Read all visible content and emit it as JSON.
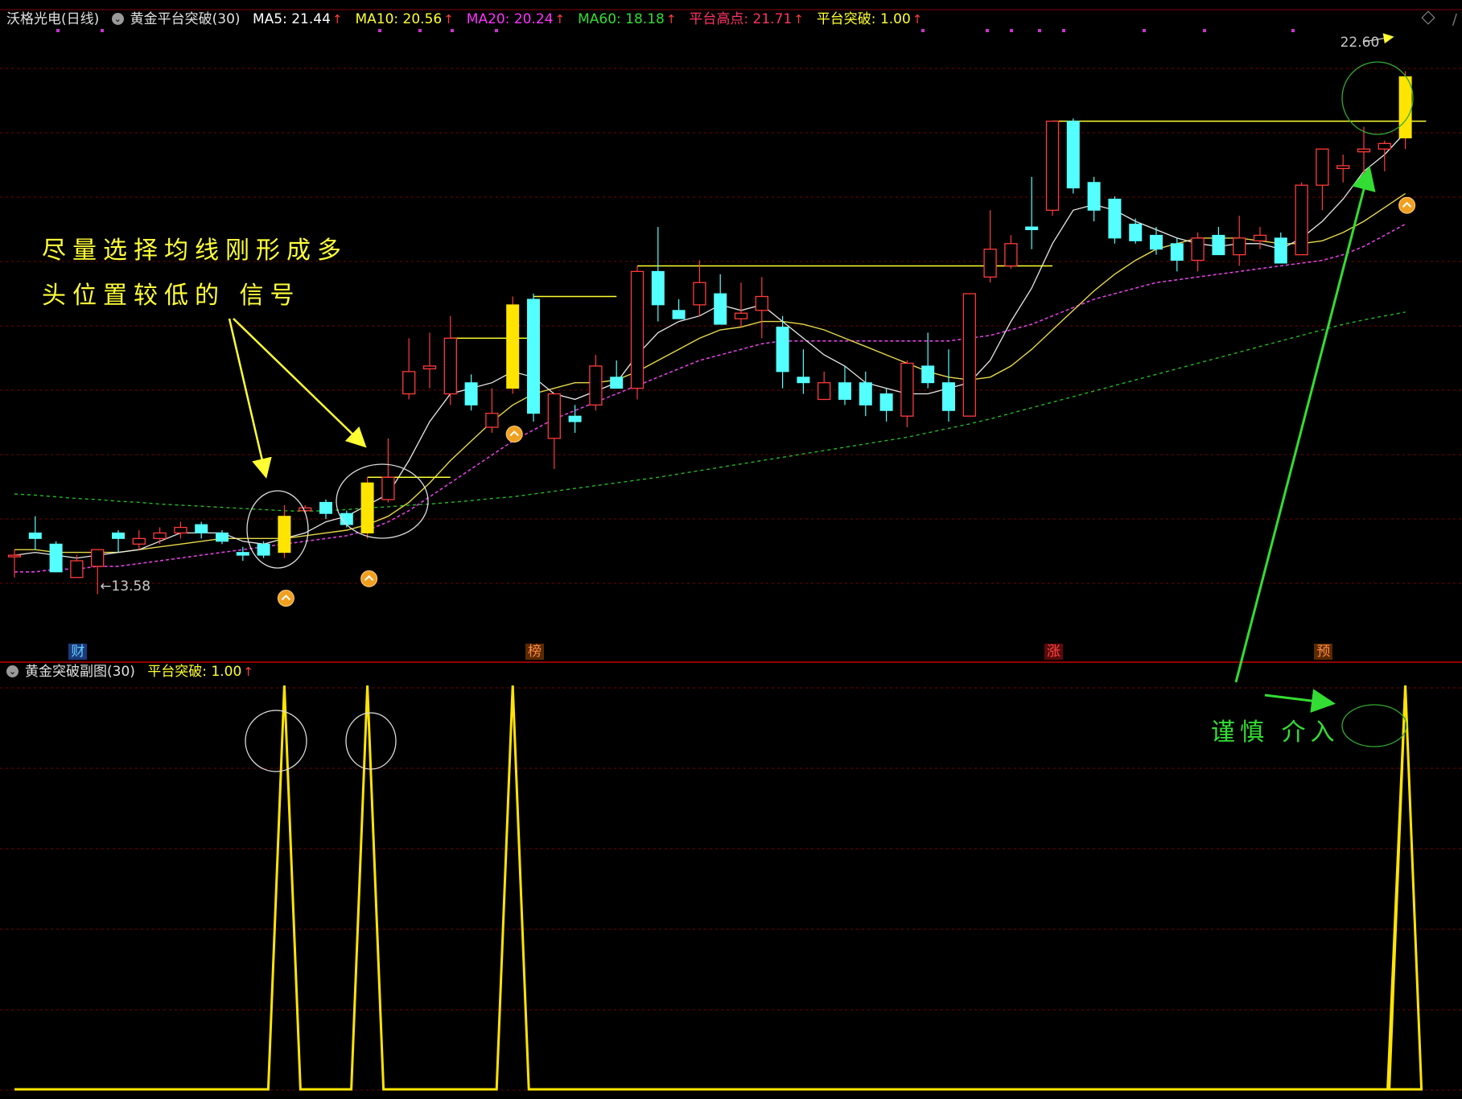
{
  "header": {
    "stock_name": "沃格光电(日线)",
    "indicator_name": "黄金平台突破(30)",
    "items": [
      {
        "label": "MA5: 21.44",
        "color": "#ffffff"
      },
      {
        "label": "MA10: 20.56",
        "color": "#ffff33"
      },
      {
        "label": "MA20: 20.24",
        "color": "#ff33ff"
      },
      {
        "label": "MA60: 18.18",
        "color": "#33dd33"
      },
      {
        "label": "平台高点: 21.71",
        "color": "#ff3366"
      },
      {
        "label": "平台突破: 1.00",
        "color": "#ffff33"
      }
    ]
  },
  "sub_header": {
    "indicator_name": "黄金突破副图(30)",
    "item": {
      "label": "平台突破: 1.00",
      "color": "#ffff33"
    }
  },
  "annotations": {
    "note_line1": "尽量选择均线刚形成多",
    "note_line2": "头位置较低的 信号",
    "note_caution": "谨慎 介入"
  },
  "events": [
    {
      "label": "财",
      "index": 3,
      "color": "#66ccff",
      "bg": "#1a3a7a"
    },
    {
      "label": "榜",
      "index": 25,
      "color": "#ff8844",
      "bg": "#5a2a00"
    },
    {
      "label": "涨",
      "index": 50,
      "color": "#ff4444",
      "bg": "#5a0a0a"
    },
    {
      "label": "预",
      "index": 63,
      "color": "#ff8844",
      "bg": "#5a2a00"
    }
  ],
  "colors": {
    "up": "#ff3b3b",
    "down": "#54ffff",
    "signal": "#ffe400",
    "ma5": "#e8e8e8",
    "ma10": "#e6d84a",
    "ma20": "#e040e0",
    "ma60": "#22bb22",
    "grid": "#7a0000",
    "platform": "#ffff33",
    "callout": "#ffff33",
    "caution": "#33dd33"
  },
  "chart_data": [
    {
      "type": "candlestick",
      "title": "沃格光电(日线)",
      "ylim": [
        12.6,
        23.3
      ],
      "grid": true,
      "price_labels": [
        {
          "index": 4,
          "value": 13.58,
          "text": "←13.58"
        },
        {
          "index": 67,
          "value": 22.6,
          "text": "22.60"
        }
      ],
      "candles": [
        {
          "o": 13.9,
          "h": 14.0,
          "l": 13.5,
          "c": 13.9,
          "s": "up"
        },
        {
          "o": 14.2,
          "h": 14.6,
          "l": 14.0,
          "c": 14.3,
          "s": "down"
        },
        {
          "o": 14.1,
          "h": 14.15,
          "l": 13.6,
          "c": 13.6,
          "s": "down"
        },
        {
          "o": 13.5,
          "h": 13.9,
          "l": 13.5,
          "c": 13.8,
          "s": "up"
        },
        {
          "o": 13.7,
          "h": 14.0,
          "l": 13.2,
          "c": 14.0,
          "s": "up"
        },
        {
          "o": 14.3,
          "h": 14.35,
          "l": 13.95,
          "c": 14.2,
          "s": "down"
        },
        {
          "o": 14.1,
          "h": 14.35,
          "l": 14.0,
          "c": 14.2,
          "s": "up"
        },
        {
          "o": 14.2,
          "h": 14.4,
          "l": 14.1,
          "c": 14.3,
          "s": "up"
        },
        {
          "o": 14.3,
          "h": 14.5,
          "l": 14.2,
          "c": 14.4,
          "s": "up"
        },
        {
          "o": 14.45,
          "h": 14.5,
          "l": 14.2,
          "c": 14.3,
          "s": "down"
        },
        {
          "o": 14.3,
          "h": 14.35,
          "l": 14.1,
          "c": 14.15,
          "s": "down"
        },
        {
          "o": 13.9,
          "h": 14.05,
          "l": 13.8,
          "c": 13.95,
          "s": "down"
        },
        {
          "o": 14.1,
          "h": 14.15,
          "l": 13.85,
          "c": 13.9,
          "s": "down"
        },
        {
          "o": 13.95,
          "h": 14.8,
          "l": 13.85,
          "c": 14.6,
          "s": "signal"
        },
        {
          "o": 14.7,
          "h": 14.8,
          "l": 14.65,
          "c": 14.75,
          "s": "up"
        },
        {
          "o": 14.85,
          "h": 14.9,
          "l": 14.55,
          "c": 14.65,
          "s": "down"
        },
        {
          "o": 14.65,
          "h": 14.7,
          "l": 14.4,
          "c": 14.45,
          "s": "down"
        },
        {
          "o": 14.3,
          "h": 15.3,
          "l": 14.2,
          "c": 15.2,
          "s": "signal"
        },
        {
          "o": 14.9,
          "h": 16.0,
          "l": 14.85,
          "c": 15.3,
          "s": "up"
        },
        {
          "o": 16.8,
          "h": 17.8,
          "l": 16.7,
          "c": 17.2,
          "s": "up"
        },
        {
          "o": 17.25,
          "h": 17.9,
          "l": 16.9,
          "c": 17.3,
          "s": "up"
        },
        {
          "o": 16.8,
          "h": 18.2,
          "l": 16.6,
          "c": 17.8,
          "s": "up"
        },
        {
          "o": 17.0,
          "h": 17.15,
          "l": 16.5,
          "c": 16.6,
          "s": "down"
        },
        {
          "o": 16.2,
          "h": 16.9,
          "l": 16.1,
          "c": 16.45,
          "s": "up"
        },
        {
          "o": 16.9,
          "h": 18.55,
          "l": 16.8,
          "c": 18.4,
          "s": "signal"
        },
        {
          "o": 18.5,
          "h": 18.6,
          "l": 16.3,
          "c": 16.45,
          "s": "down"
        },
        {
          "o": 16.0,
          "h": 16.7,
          "l": 15.45,
          "c": 16.8,
          "s": "up"
        },
        {
          "o": 16.4,
          "h": 16.6,
          "l": 16.1,
          "c": 16.3,
          "s": "down"
        },
        {
          "o": 16.6,
          "h": 17.5,
          "l": 16.5,
          "c": 17.3,
          "s": "up"
        },
        {
          "o": 17.1,
          "h": 17.4,
          "l": 16.9,
          "c": 16.9,
          "s": "down"
        },
        {
          "o": 16.9,
          "h": 19.1,
          "l": 16.7,
          "c": 19.0,
          "s": "up"
        },
        {
          "o": 19.0,
          "h": 19.8,
          "l": 18.1,
          "c": 18.4,
          "s": "down"
        },
        {
          "o": 18.3,
          "h": 18.5,
          "l": 18.2,
          "c": 18.15,
          "s": "down"
        },
        {
          "o": 18.4,
          "h": 19.2,
          "l": 18.2,
          "c": 18.8,
          "s": "up"
        },
        {
          "o": 18.6,
          "h": 18.95,
          "l": 18.4,
          "c": 18.05,
          "s": "down"
        },
        {
          "o": 18.15,
          "h": 18.8,
          "l": 18.0,
          "c": 18.25,
          "s": "up"
        },
        {
          "o": 18.3,
          "h": 18.9,
          "l": 17.8,
          "c": 18.55,
          "s": "up"
        },
        {
          "o": 18.0,
          "h": 18.2,
          "l": 16.9,
          "c": 17.2,
          "s": "down"
        },
        {
          "o": 17.1,
          "h": 17.6,
          "l": 16.8,
          "c": 17.0,
          "s": "down"
        },
        {
          "o": 16.7,
          "h": 17.2,
          "l": 16.7,
          "c": 17.0,
          "s": "up"
        },
        {
          "o": 17.0,
          "h": 17.3,
          "l": 16.6,
          "c": 16.7,
          "s": "down"
        },
        {
          "o": 17.0,
          "h": 17.2,
          "l": 16.4,
          "c": 16.6,
          "s": "down"
        },
        {
          "o": 16.8,
          "h": 16.9,
          "l": 16.3,
          "c": 16.5,
          "s": "down"
        },
        {
          "o": 16.4,
          "h": 17.4,
          "l": 16.2,
          "c": 17.35,
          "s": "up"
        },
        {
          "o": 17.3,
          "h": 17.9,
          "l": 16.9,
          "c": 17.0,
          "s": "down"
        },
        {
          "o": 17.0,
          "h": 17.6,
          "l": 16.3,
          "c": 16.5,
          "s": "down"
        },
        {
          "o": 16.4,
          "h": 18.6,
          "l": 16.4,
          "c": 18.6,
          "s": "up"
        },
        {
          "o": 18.9,
          "h": 20.1,
          "l": 18.8,
          "c": 19.4,
          "s": "up"
        },
        {
          "o": 19.1,
          "h": 19.65,
          "l": 19.05,
          "c": 19.5,
          "s": "up"
        },
        {
          "o": 19.8,
          "h": 20.7,
          "l": 19.4,
          "c": 19.75,
          "s": "down"
        },
        {
          "o": 20.1,
          "h": 21.7,
          "l": 20.0,
          "c": 21.7,
          "s": "up"
        },
        {
          "o": 21.7,
          "h": 21.75,
          "l": 20.4,
          "c": 20.5,
          "s": "down"
        },
        {
          "o": 20.6,
          "h": 20.7,
          "l": 19.9,
          "c": 20.1,
          "s": "down"
        },
        {
          "o": 20.3,
          "h": 20.35,
          "l": 19.5,
          "c": 19.6,
          "s": "down"
        },
        {
          "o": 19.85,
          "h": 19.95,
          "l": 19.5,
          "c": 19.55,
          "s": "down"
        },
        {
          "o": 19.65,
          "h": 19.8,
          "l": 19.3,
          "c": 19.4,
          "s": "down"
        },
        {
          "o": 19.5,
          "h": 19.6,
          "l": 19.0,
          "c": 19.2,
          "s": "down"
        },
        {
          "o": 19.2,
          "h": 19.7,
          "l": 19.0,
          "c": 19.6,
          "s": "up"
        },
        {
          "o": 19.65,
          "h": 19.8,
          "l": 19.35,
          "c": 19.3,
          "s": "down"
        },
        {
          "o": 19.3,
          "h": 20.0,
          "l": 19.1,
          "c": 19.6,
          "s": "up"
        },
        {
          "o": 19.65,
          "h": 19.8,
          "l": 19.4,
          "c": 19.55,
          "s": "up"
        },
        {
          "o": 19.6,
          "h": 19.7,
          "l": 19.2,
          "c": 19.15,
          "s": "down"
        },
        {
          "o": 19.3,
          "h": 20.6,
          "l": 19.3,
          "c": 20.55,
          "s": "up"
        },
        {
          "o": 20.55,
          "h": 21.0,
          "l": 20.1,
          "c": 21.2,
          "s": "up"
        },
        {
          "o": 20.85,
          "h": 21.1,
          "l": 20.6,
          "c": 20.9,
          "s": "up"
        },
        {
          "o": 21.15,
          "h": 21.6,
          "l": 20.6,
          "c": 21.2,
          "s": "up"
        },
        {
          "o": 21.2,
          "h": 21.35,
          "l": 20.8,
          "c": 21.3,
          "s": "up"
        },
        {
          "o": 21.4,
          "h": 22.6,
          "l": 21.2,
          "c": 22.5,
          "s": "signal"
        }
      ],
      "ma5": [
        13.9,
        13.95,
        13.9,
        13.85,
        13.9,
        13.95,
        14.0,
        14.15,
        14.3,
        14.3,
        14.3,
        14.15,
        14.1,
        14.2,
        14.3,
        14.5,
        14.6,
        14.8,
        15.0,
        15.6,
        16.3,
        16.8,
        16.9,
        17.0,
        17.2,
        17.1,
        16.8,
        16.7,
        16.85,
        17.0,
        17.5,
        17.9,
        18.1,
        18.2,
        18.4,
        18.3,
        18.4,
        18.1,
        17.8,
        17.5,
        17.3,
        17.0,
        16.9,
        16.8,
        16.8,
        16.9,
        17.0,
        17.4,
        18.1,
        18.7,
        19.5,
        20.1,
        20.2,
        20.1,
        19.9,
        19.75,
        19.6,
        19.5,
        19.45,
        19.5,
        19.5,
        19.4,
        19.6,
        19.9,
        20.3,
        20.8,
        21.1,
        21.5
      ],
      "ma10": [
        14.0,
        14.0,
        13.95,
        13.95,
        13.95,
        13.95,
        14.0,
        14.05,
        14.1,
        14.15,
        14.2,
        14.2,
        14.2,
        14.2,
        14.25,
        14.3,
        14.35,
        14.45,
        14.6,
        14.85,
        15.2,
        15.6,
        15.95,
        16.3,
        16.6,
        16.8,
        16.9,
        17.0,
        17.0,
        17.05,
        17.2,
        17.4,
        17.6,
        17.8,
        17.95,
        18.0,
        18.1,
        18.1,
        18.05,
        17.95,
        17.8,
        17.65,
        17.5,
        17.35,
        17.2,
        17.1,
        17.05,
        17.1,
        17.3,
        17.6,
        17.95,
        18.3,
        18.65,
        18.95,
        19.2,
        19.4,
        19.5,
        19.6,
        19.6,
        19.6,
        19.55,
        19.5,
        19.5,
        19.55,
        19.7,
        19.9,
        20.15,
        20.4
      ],
      "ma20": [
        13.6,
        13.6,
        13.65,
        13.65,
        13.7,
        13.7,
        13.75,
        13.8,
        13.85,
        13.9,
        13.95,
        14.0,
        14.05,
        14.1,
        14.15,
        14.2,
        14.25,
        14.35,
        14.5,
        14.7,
        14.95,
        15.2,
        15.45,
        15.7,
        15.95,
        16.15,
        16.35,
        16.5,
        16.65,
        16.8,
        16.95,
        17.1,
        17.25,
        17.4,
        17.5,
        17.6,
        17.7,
        17.75,
        17.75,
        17.75,
        17.75,
        17.75,
        17.75,
        17.75,
        17.75,
        17.75,
        17.8,
        17.85,
        17.95,
        18.05,
        18.2,
        18.35,
        18.5,
        18.6,
        18.7,
        18.8,
        18.85,
        18.9,
        18.95,
        19.0,
        19.05,
        19.1,
        19.15,
        19.2,
        19.3,
        19.45,
        19.65,
        19.85
      ],
      "ma60": [
        15.0,
        14.98,
        14.95,
        14.92,
        14.9,
        14.87,
        14.85,
        14.82,
        14.8,
        14.78,
        14.76,
        14.74,
        14.72,
        14.7,
        14.69,
        14.7,
        14.72,
        14.75,
        14.77,
        14.8,
        14.82,
        14.85,
        14.88,
        14.92,
        14.95,
        15.0,
        15.05,
        15.1,
        15.15,
        15.2,
        15.25,
        15.3,
        15.36,
        15.42,
        15.48,
        15.54,
        15.6,
        15.66,
        15.72,
        15.78,
        15.84,
        15.9,
        15.96,
        16.02,
        16.1,
        16.18,
        16.26,
        16.35,
        16.45,
        16.55,
        16.65,
        16.75,
        16.85,
        16.95,
        17.05,
        17.15,
        17.25,
        17.35,
        17.45,
        17.55,
        17.65,
        17.75,
        17.85,
        17.95,
        18.05,
        18.13,
        18.2,
        18.27
      ],
      "platform_lines": [
        {
          "start": 21,
          "end": 25,
          "value": 17.8
        },
        {
          "start": 25,
          "end": 29,
          "value": 18.55
        },
        {
          "start": 30,
          "end": 50,
          "value": 19.1
        },
        {
          "start": 50,
          "end": 68,
          "value": 21.7
        },
        {
          "start": 17,
          "end": 21,
          "value": 15.3
        }
      ],
      "signal_markers": [
        13,
        17,
        24,
        67
      ]
    },
    {
      "type": "line",
      "title": "黄金突破副图(30)",
      "series": [
        {
          "name": "平台突破",
          "values": [
            0,
            0,
            0,
            0,
            0,
            0,
            0,
            0,
            0,
            0,
            0,
            0,
            0,
            1,
            0,
            0,
            0,
            1,
            0,
            0,
            0,
            0,
            0,
            0,
            1,
            0,
            0,
            0,
            0,
            0,
            0,
            0,
            0,
            0,
            0,
            0,
            0,
            0,
            0,
            0,
            0,
            0,
            0,
            0,
            0,
            0,
            0,
            0,
            0,
            0,
            0,
            0,
            0,
            0,
            0,
            0,
            0,
            0,
            0,
            0,
            0,
            0,
            0,
            0,
            0,
            0,
            0,
            1
          ]
        }
      ],
      "ylim": [
        0,
        1
      ]
    }
  ]
}
